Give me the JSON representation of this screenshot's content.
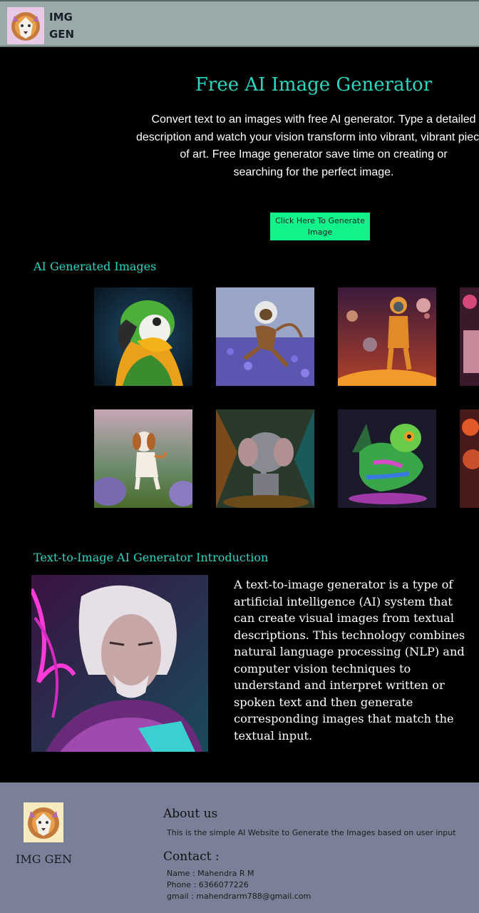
{
  "header": {
    "brand_line1": "IMG",
    "brand_line2": "GEN",
    "logo_icon": "lion-logo-icon"
  },
  "hero": {
    "title": "Free AI Image Generator",
    "description_lines": [
      "Convert text to an images with free AI generator. Type a detailed",
      "description and watch your vision transform into vibrant, vibrant pieces",
      "of art.  Free Image generator save time on creating or",
      "searching for the perfect image."
    ],
    "button_label": "Click Here To Generate Image"
  },
  "gallery": {
    "title": "AI Generated Images",
    "images": [
      "parrot-image",
      "astronaut-monkey-image",
      "astronaut-space-image",
      "partial-image-1",
      "beagle-dog-image",
      "elephant-image",
      "chameleon-image",
      "partial-image-2"
    ]
  },
  "intro": {
    "title": "Text-to-Image AI Generator Introduction",
    "image": "white-haired-warrior-image",
    "text_lines": [
      "A text-to-image generator is a type of",
      "artificial intelligence (AI) system that",
      "can create visual images from textual",
      "descriptions. This technology combines",
      "natural language processing (NLP) and",
      "computer vision techniques to",
      "understand and interpret written or",
      "spoken text and then generate",
      "corresponding images that match the",
      "textual input."
    ]
  },
  "footer": {
    "brand": "IMG GEN",
    "about_title": "About us",
    "about_text": "This is the simple AI Website to Generate the Images based on user input",
    "contact_title": "Contact :",
    "contact_name": "Name : Mahendra R M",
    "contact_phone": "Phone : 6366077226",
    "contact_email": "gmail : mahendrarm788@gmail.com"
  },
  "colors": {
    "accent": "#2ad6c2",
    "button": "#11f28a",
    "header_bg": "#9aaaa8",
    "footer_bg": "#7a8097"
  }
}
